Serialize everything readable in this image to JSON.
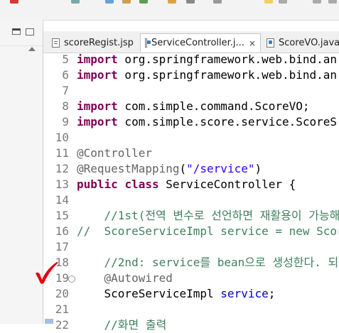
{
  "tabs": [
    {
      "label": "scoreRegist.jsp",
      "icon": "jsp-file-icon",
      "active": false
    },
    {
      "label": "ServiceController.j...",
      "icon": "java-file-icon",
      "active": true,
      "close": "×"
    },
    {
      "label": "ScoreVO.java",
      "icon": "java-file-icon",
      "active": false
    }
  ],
  "colors": {
    "keyword": "#7f0055",
    "annotation": "#646464",
    "string": "#2a00ff",
    "comment": "#3f7f5f",
    "field": "#0000c0",
    "checkmark": "#e30613"
  },
  "code": {
    "lines": [
      {
        "n": "5",
        "t": [
          {
            "c": "kw",
            "v": "import"
          },
          {
            "c": "pl",
            "v": " org.springframework.web.bind.an"
          }
        ]
      },
      {
        "n": "6",
        "t": [
          {
            "c": "kw",
            "v": "import"
          },
          {
            "c": "pl",
            "v": " org.springframework.web.bind.an"
          }
        ]
      },
      {
        "n": "7",
        "t": []
      },
      {
        "n": "8",
        "t": [
          {
            "c": "kw",
            "v": "import"
          },
          {
            "c": "pl",
            "v": " com.simple.command.ScoreVO;"
          }
        ]
      },
      {
        "n": "9",
        "t": [
          {
            "c": "kw",
            "v": "import"
          },
          {
            "c": "pl",
            "v": " com.simple.score.service.ScoreS"
          }
        ]
      },
      {
        "n": "10",
        "t": []
      },
      {
        "n": "11",
        "t": [
          {
            "c": "ann",
            "v": "@Controller"
          }
        ]
      },
      {
        "n": "12",
        "t": [
          {
            "c": "ann",
            "v": "@RequestMapping"
          },
          {
            "c": "pl",
            "v": "("
          },
          {
            "c": "str",
            "v": "\"/service\""
          },
          {
            "c": "pl",
            "v": ")"
          }
        ]
      },
      {
        "n": "13",
        "t": [
          {
            "c": "kw",
            "v": "public"
          },
          {
            "c": "pl",
            "v": " "
          },
          {
            "c": "kw",
            "v": "class"
          },
          {
            "c": "pl",
            "v": " ServiceController {"
          }
        ]
      },
      {
        "n": "14",
        "t": []
      },
      {
        "n": "15",
        "t": [
          {
            "c": "cm",
            "v": "    //1st(전역 변수로 선언하면 재활용이 가능해"
          }
        ]
      },
      {
        "n": "16",
        "t": [
          {
            "c": "cm",
            "v": "//  ScoreServiceImpl service = new Scor"
          }
        ]
      },
      {
        "n": "17",
        "t": []
      },
      {
        "n": "18",
        "t": [
          {
            "c": "cm",
            "v": "    //2nd: service를 bean으로 생성한다. 되"
          }
        ]
      },
      {
        "n": "19",
        "fold": "⊖",
        "t": [
          {
            "c": "pl",
            "v": "    "
          },
          {
            "c": "ann",
            "v": "@Autowired"
          }
        ]
      },
      {
        "n": "20",
        "t": [
          {
            "c": "pl",
            "v": "    ScoreServiceImpl "
          },
          {
            "c": "fld",
            "v": "service"
          },
          {
            "c": "pl",
            "v": ";"
          }
        ]
      },
      {
        "n": "21",
        "t": []
      },
      {
        "n": "22",
        "t": [
          {
            "c": "cm",
            "v": "    //화면 출력"
          }
        ]
      }
    ]
  }
}
